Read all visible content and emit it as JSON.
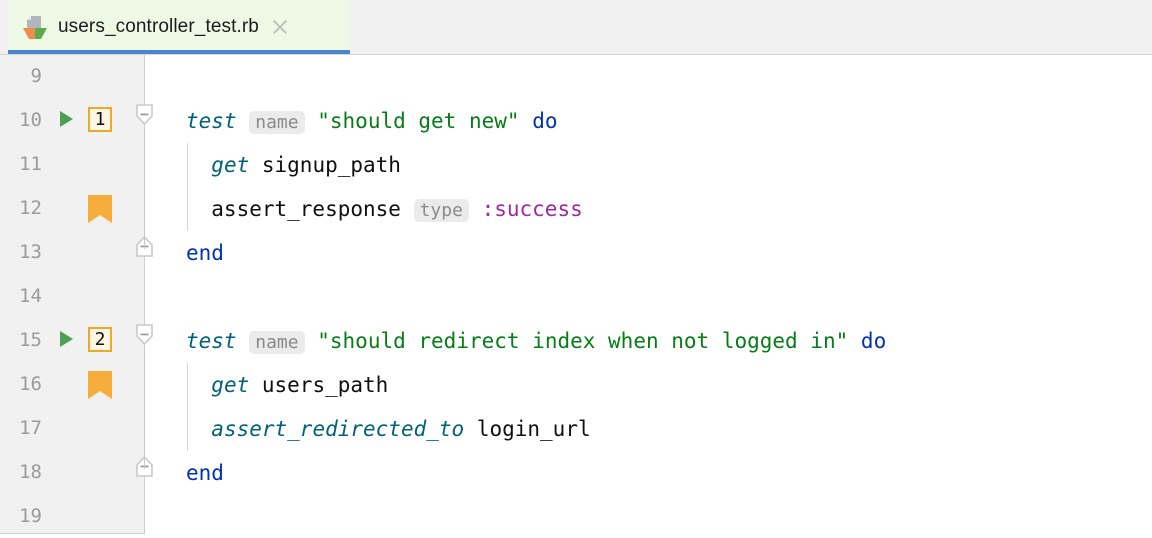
{
  "tab": {
    "filename": "users_controller_test.rb",
    "icon": "ruby-test-file-icon",
    "close_icon": "close-icon",
    "active": true,
    "underline_color": "#4a86c8",
    "background_color": "#edf8e5"
  },
  "editor": {
    "gutter_background": "#f1f1f1",
    "background": "#ffffff",
    "colors": {
      "keyword": "#0033b3",
      "method": "#00627a",
      "string": "#067d17",
      "symbol": "#a0299f",
      "plain": "#0f0f0f",
      "line_number": "#9b9b9b",
      "hint_background": "#ebebeb",
      "hint_text": "#8a8a8a",
      "run_marker": "#4f9e55",
      "bookmark": "#f5ad3c",
      "badge_border": "#eda92c",
      "badge_fill": "#fdf6e3"
    },
    "lines": [
      {
        "number": "9",
        "run_marker": false,
        "badge": null,
        "bookmark": false,
        "fold": null,
        "tokens": []
      },
      {
        "number": "10",
        "run_marker": true,
        "badge": "1",
        "bookmark": false,
        "fold": "start",
        "tokens": [
          {
            "text": "test",
            "type": "method"
          },
          {
            "text": " ",
            "type": "plain"
          },
          {
            "text": "name",
            "type": "hint"
          },
          {
            "text": " ",
            "type": "plain"
          },
          {
            "text": "\"should get new\"",
            "type": "string"
          },
          {
            "text": " ",
            "type": "plain"
          },
          {
            "text": "do",
            "type": "keyword"
          }
        ]
      },
      {
        "number": "11",
        "run_marker": false,
        "badge": null,
        "bookmark": false,
        "fold": null,
        "tokens": [
          {
            "text": "  ",
            "type": "plain"
          },
          {
            "text": "get",
            "type": "method"
          },
          {
            "text": " signup_path",
            "type": "plain"
          }
        ]
      },
      {
        "number": "12",
        "run_marker": false,
        "badge": null,
        "bookmark": true,
        "fold": null,
        "tokens": [
          {
            "text": "  assert_response ",
            "type": "plain"
          },
          {
            "text": "type",
            "type": "hint"
          },
          {
            "text": " ",
            "type": "plain"
          },
          {
            "text": ":success",
            "type": "symbol"
          }
        ]
      },
      {
        "number": "13",
        "run_marker": false,
        "badge": null,
        "bookmark": false,
        "fold": "end",
        "tokens": [
          {
            "text": "end",
            "type": "keyword"
          }
        ]
      },
      {
        "number": "14",
        "run_marker": false,
        "badge": null,
        "bookmark": false,
        "fold": null,
        "tokens": []
      },
      {
        "number": "15",
        "run_marker": true,
        "badge": "2",
        "bookmark": false,
        "fold": "start",
        "tokens": [
          {
            "text": "test",
            "type": "method"
          },
          {
            "text": " ",
            "type": "plain"
          },
          {
            "text": "name",
            "type": "hint"
          },
          {
            "text": " ",
            "type": "plain"
          },
          {
            "text": "\"should redirect index when not logged in\"",
            "type": "string"
          },
          {
            "text": " ",
            "type": "plain"
          },
          {
            "text": "do",
            "type": "keyword"
          }
        ]
      },
      {
        "number": "16",
        "run_marker": false,
        "badge": null,
        "bookmark": true,
        "fold": null,
        "tokens": [
          {
            "text": "  ",
            "type": "plain"
          },
          {
            "text": "get",
            "type": "method"
          },
          {
            "text": " users_path",
            "type": "plain"
          }
        ]
      },
      {
        "number": "17",
        "run_marker": false,
        "badge": null,
        "bookmark": false,
        "fold": null,
        "tokens": [
          {
            "text": "  ",
            "type": "plain"
          },
          {
            "text": "assert_redirected_to",
            "type": "method"
          },
          {
            "text": " login_url",
            "type": "plain"
          }
        ]
      },
      {
        "number": "18",
        "run_marker": false,
        "badge": null,
        "bookmark": false,
        "fold": "end",
        "tokens": [
          {
            "text": "end",
            "type": "keyword"
          }
        ]
      },
      {
        "number": "19",
        "run_marker": false,
        "badge": null,
        "bookmark": false,
        "fold": null,
        "tokens": []
      }
    ]
  }
}
